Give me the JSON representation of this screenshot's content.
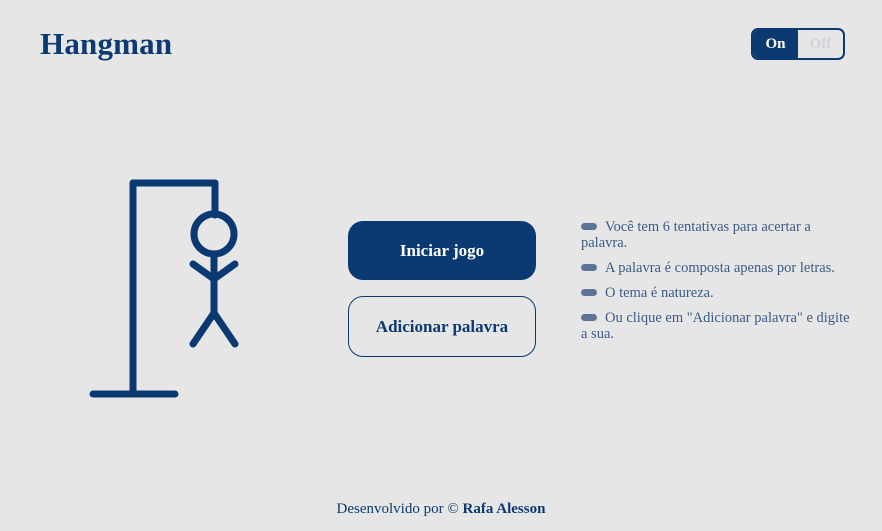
{
  "header": {
    "title": "Hangman"
  },
  "theme_toggle": {
    "on_label": "On",
    "off_label": "Off",
    "selected": "On"
  },
  "actions": {
    "start_label": "Iniciar jogo",
    "add_word_label": "Adicionar palavra"
  },
  "rules": [
    "Você tem 6 tentativas para acertar a palavra.",
    "A palavra é composta apenas por letras.",
    "O tema é natureza.",
    "Ou clique em \"Adicionar palavra\" e digite a sua."
  ],
  "footer": {
    "prefix": "Desenvolvido por",
    "copyright": "©",
    "author": "Rafa Alesson"
  },
  "colors": {
    "primary": "#0b3a72",
    "background": "#e6e6e7",
    "text_muted": "#3c5a86"
  }
}
